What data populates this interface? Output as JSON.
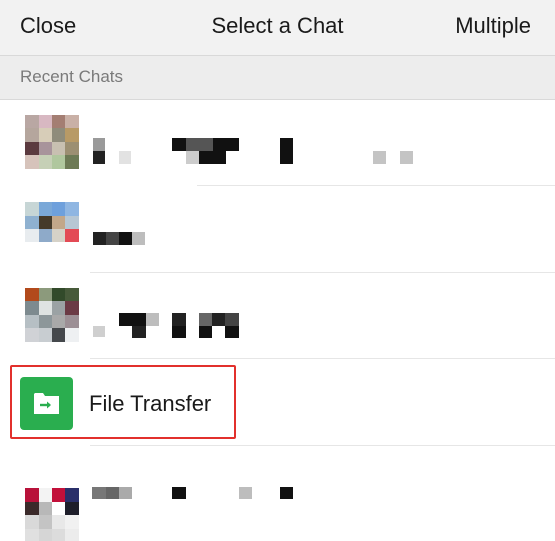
{
  "header": {
    "close_label": "Close",
    "title": "Select a Chat",
    "multiple_label": "Multiple"
  },
  "section": {
    "label": "Recent Chats"
  },
  "chats": [
    {
      "name": "",
      "avatar": "pixelated-avatar"
    },
    {
      "name": "",
      "avatar": "pixelated-avatar"
    },
    {
      "name": "",
      "avatar": "pixelated-avatar"
    },
    {
      "name": "File Transfer",
      "avatar": "folder-transfer-icon",
      "highlighted": true
    },
    {
      "name": "",
      "avatar": "pixelated-avatar"
    }
  ],
  "colors": {
    "file_transfer_green": "#2aae4f",
    "highlight_red": "#e2302c"
  }
}
